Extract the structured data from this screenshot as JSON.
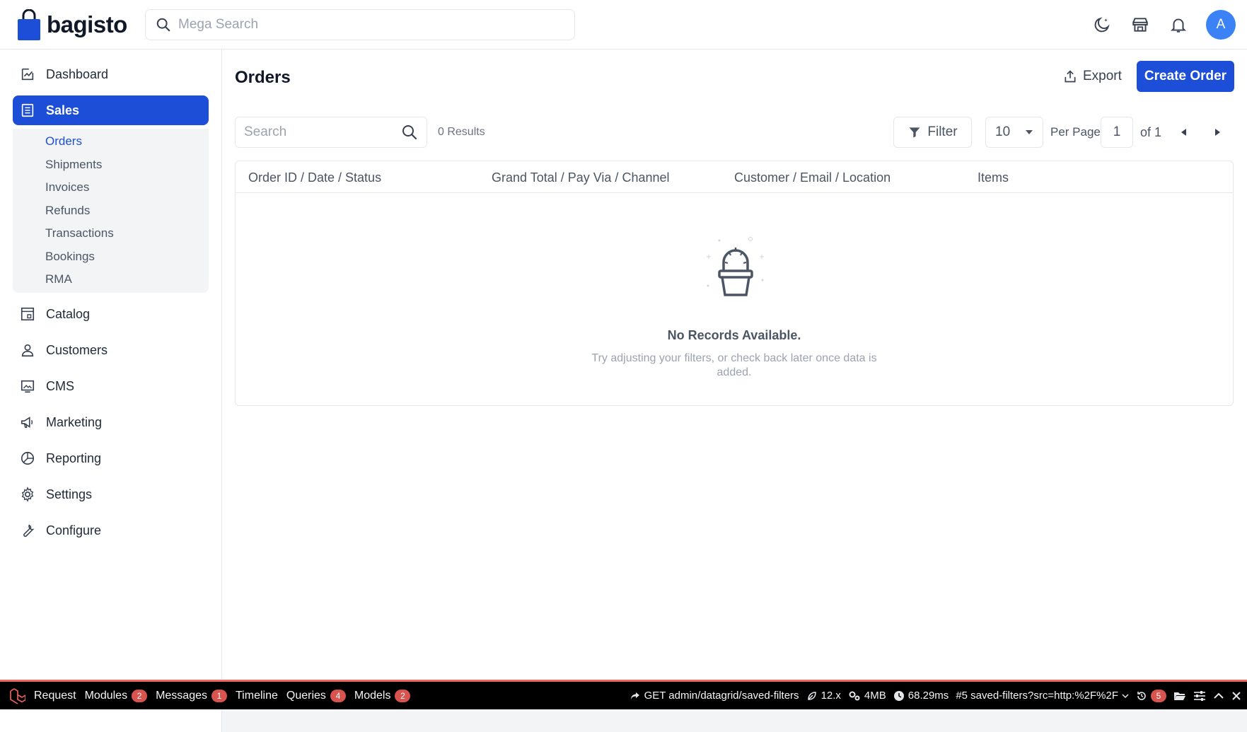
{
  "header": {
    "brand": "bagisto",
    "mega_search_placeholder": "Mega Search",
    "avatar_initial": "A",
    "icons": [
      "moon-icon",
      "storefront-icon",
      "bell-icon"
    ]
  },
  "sidebar": {
    "items": [
      {
        "label": "Dashboard",
        "icon": "dashboard-icon"
      },
      {
        "label": "Sales",
        "icon": "sales-icon",
        "active": true
      },
      {
        "label": "Catalog",
        "icon": "catalog-icon"
      },
      {
        "label": "Customers",
        "icon": "customers-icon"
      },
      {
        "label": "CMS",
        "icon": "cms-icon"
      },
      {
        "label": "Marketing",
        "icon": "megaphone-icon"
      },
      {
        "label": "Reporting",
        "icon": "reporting-icon"
      },
      {
        "label": "Settings",
        "icon": "gear-icon"
      },
      {
        "label": "Configure",
        "icon": "wrench-icon"
      }
    ],
    "sales_sub": [
      "Orders",
      "Shipments",
      "Invoices",
      "Refunds",
      "Transactions",
      "Bookings",
      "RMA"
    ]
  },
  "main": {
    "title": "Orders",
    "export_label": "Export",
    "create_label": "Create Order",
    "search_placeholder": "Search",
    "results": "0 Results",
    "filter_label": "Filter",
    "per_page_value": "10",
    "per_page_label": "Per Page",
    "page_value": "1",
    "of_label": "of 1",
    "columns": [
      "Order ID / Date / Status",
      "Grand Total / Pay Via / Channel",
      "Customer / Email / Location",
      "Items"
    ],
    "empty_title": "No Records Available.",
    "empty_desc": "Try adjusting your filters, or check back later once data is added."
  },
  "debugbar": {
    "tabs": [
      {
        "label": "Request"
      },
      {
        "label": "Modules",
        "badge": "2"
      },
      {
        "label": "Messages",
        "badge": "1"
      },
      {
        "label": "Timeline"
      },
      {
        "label": "Queries",
        "badge": "4"
      },
      {
        "label": "Models",
        "badge": "2"
      }
    ],
    "route": "GET admin/datagrid/saved-filters",
    "version": "12.x",
    "memory": "4MB",
    "duration": "68.29ms",
    "request": "#5 saved-filters?src=http:%2F%2F",
    "history_badge": "5"
  },
  "colors": {
    "primary": "#1d4ed8",
    "avatar": "#3b82f6",
    "debug_accent": "#f4645f",
    "badge": "#d9534f"
  }
}
